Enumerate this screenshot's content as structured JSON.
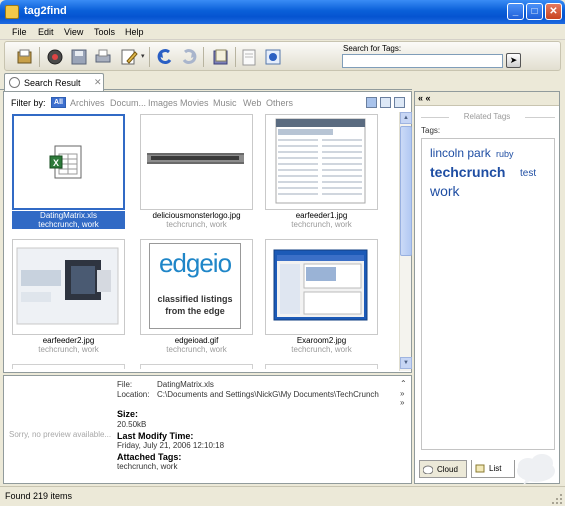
{
  "window": {
    "title": "tag2find",
    "controls": {
      "minimize": "_",
      "maximize": "□",
      "close": "✕"
    }
  },
  "menu": [
    "File",
    "Edit",
    "View",
    "Tools",
    "Help"
  ],
  "toolbar": {
    "search_label": "Search for Tags:",
    "search_value": "",
    "buttons": [
      "new-tag-icon",
      "explore-icon",
      "save-icon",
      "print-icon",
      "edit-icon",
      "back-icon",
      "forward-icon",
      "book-icon",
      "document-icon",
      "help-icon"
    ]
  },
  "tab": {
    "label": "Search Result",
    "close": "✕"
  },
  "filter": {
    "label": "Filter by:",
    "all_label": "All",
    "items": [
      "Archives",
      "Docum...",
      "Images",
      "Movies",
      "Music",
      "Web",
      "Others"
    ]
  },
  "items": [
    {
      "name": "DatingMatrix.xls",
      "tags": "techcrunch, work",
      "selected": true,
      "kind": "excel"
    },
    {
      "name": "deliciousmonsterlogo.jpg",
      "tags": "techcrunch, work",
      "selected": false,
      "kind": "banner"
    },
    {
      "name": "earfeeder1.jpg",
      "tags": "techcrunch, work",
      "selected": false,
      "kind": "webpage"
    },
    {
      "name": "earfeeder2.jpg",
      "tags": "techcrunch, work",
      "selected": false,
      "kind": "screenshot"
    },
    {
      "name": "edgeioad.gif",
      "tags": "techcrunch, work",
      "selected": false,
      "kind": "edgeio"
    },
    {
      "name": "Exaroom2.jpg",
      "tags": "techcrunch, work",
      "selected": false,
      "kind": "app"
    }
  ],
  "edgeio": {
    "logo": "edgeio",
    "line1": "classified listings",
    "line2": "from the edge"
  },
  "details": {
    "no_preview": "Sorry, no preview available...",
    "file_label": "File:",
    "file_value": "DatingMatrix.xls",
    "location_label": "Location:",
    "location_value": "C:\\Documents and Settings\\NickG\\My Documents\\TechCrunch",
    "size_label": "Size:",
    "size_value": "20.50kB",
    "modify_label": "Last Modify Time:",
    "modify_value": "Friday, July 21, 2006 12:10:18",
    "attached_label": "Attached Tags:",
    "attached_value": "techcrunch, work"
  },
  "status": "Found 219 items",
  "right_panel": {
    "collapse": "« «",
    "related_title": "Related Tags",
    "tags_label": "Tags:",
    "tags": [
      {
        "text": "lincoln park",
        "size": "medium"
      },
      {
        "text": "ruby",
        "size": "small"
      },
      {
        "text": "techcrunch",
        "size": "large"
      },
      {
        "text": "test",
        "size": "small"
      },
      {
        "text": "work",
        "size": "medium-large"
      }
    ],
    "tabs": [
      {
        "label": "Cloud",
        "active": false
      },
      {
        "label": "List",
        "active": true
      }
    ]
  }
}
